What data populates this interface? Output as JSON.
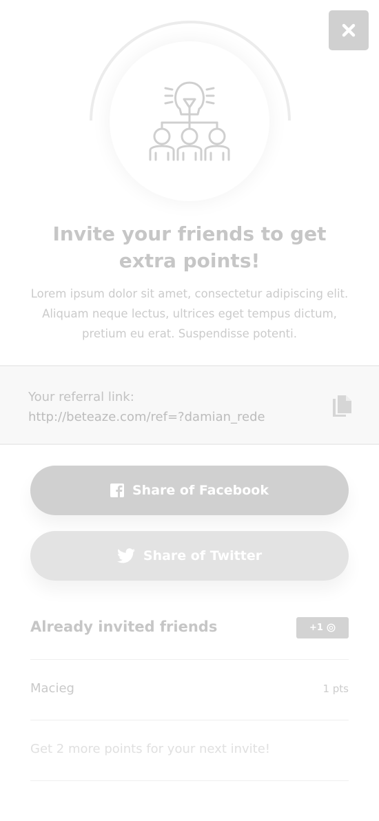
{
  "modal": {
    "close_icon": "close-icon",
    "illustration_icon": "lightbulb-team-icon"
  },
  "title": "Invite your friends to get extra points!",
  "description": "Lorem ipsum dolor sit amet, consectetur adipiscing elit. Aliquam neque lectus, ultrices eget tempus dictum, pretium eu erat. Suspendisse potenti.",
  "referral": {
    "label": "Your referral link:",
    "link": "http://beteaze.com/ref=?damian_rede",
    "copy_icon": "copy-icon"
  },
  "share": {
    "facebook_label": "Share of Facebook",
    "facebook_icon": "facebook-icon",
    "twitter_label": "Share of Twitter",
    "twitter_icon": "twitter-icon"
  },
  "invited": {
    "title": "Already invited friends",
    "badge_label": "+1",
    "badge_icon": "coin-icon",
    "friends": [
      {
        "name": "Macieg",
        "points": "1 pts"
      }
    ],
    "hint": "Get 2 more points for your next invite!"
  },
  "colors": {
    "primary_button": "#d0d0d0",
    "secondary_button": "#e3e3e3",
    "close_button": "#d0d0d0",
    "text": "#c6c6c6"
  }
}
